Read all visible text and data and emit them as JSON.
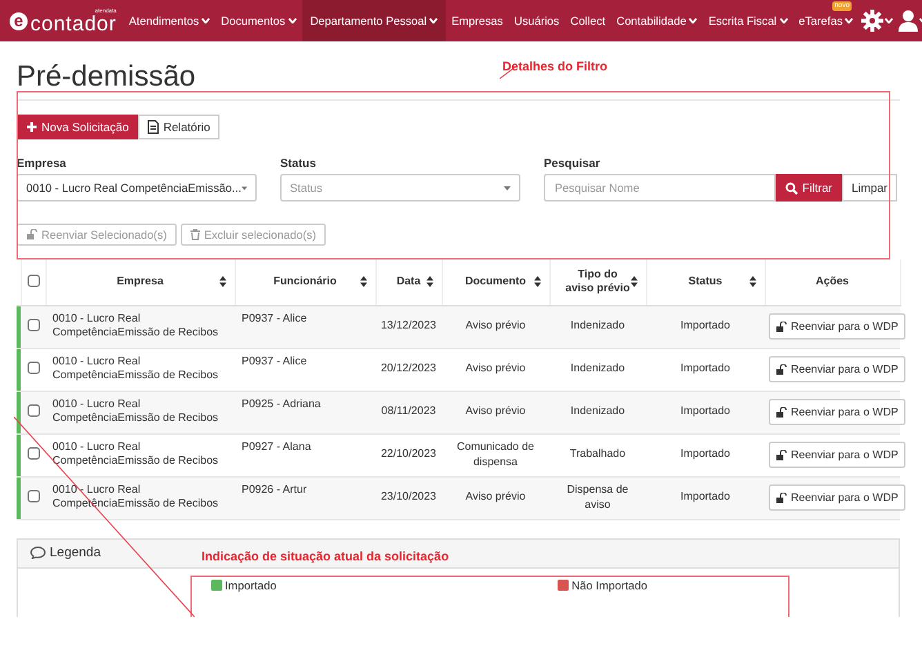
{
  "navbar": {
    "logo": {
      "mark": "e",
      "text": "contador",
      "tagline": "atendata"
    },
    "items": [
      {
        "label": "Atendimentos",
        "dropdown": true,
        "selected": false
      },
      {
        "label": "Documentos",
        "dropdown": true,
        "selected": false
      },
      {
        "label": "Departamento Pessoal",
        "dropdown": true,
        "selected": true
      },
      {
        "label": "Empresas",
        "dropdown": false,
        "selected": false
      },
      {
        "label": "Usuários",
        "dropdown": false,
        "selected": false
      },
      {
        "label": "Collect",
        "dropdown": false,
        "selected": false
      },
      {
        "label": "Contabilidade",
        "dropdown": true,
        "selected": false
      },
      {
        "label": "Escrita Fiscal",
        "dropdown": true,
        "selected": false
      },
      {
        "label": "eTarefas",
        "dropdown": true,
        "selected": false,
        "badge": "novo"
      }
    ]
  },
  "page_title": "Pré-demissão",
  "toolbar": [
    {
      "label": "Nova Solicitação",
      "kind": "primary"
    },
    {
      "label": "Relatório",
      "kind": "default"
    }
  ],
  "filters": {
    "empresa": {
      "label": "Empresa",
      "value": "0010 - Lucro Real CompetênciaEmissão..."
    },
    "status": {
      "label": "Status",
      "placeholder": "Status"
    },
    "search": {
      "label": "Pesquisar",
      "placeholder": "Pesquisar Nome",
      "buttons": [
        "Filtrar",
        "Limpar"
      ]
    }
  },
  "bulk_actions": [
    {
      "label": "Reenviar Selecionado(s)",
      "kind": "resend",
      "disabled": true
    },
    {
      "label": "Excluir selecionado(s)",
      "kind": "delete",
      "disabled": true
    }
  ],
  "table": {
    "select_all": {
      "checked": false
    },
    "columns": [
      {
        "label": "Empresa",
        "sortable": true
      },
      {
        "label": "Funcionário",
        "sortable": true
      },
      {
        "label": "Data",
        "sortable": true
      },
      {
        "label": "Documento",
        "sortable": true
      },
      {
        "label": "Tipo do aviso prévio",
        "sortable": true
      },
      {
        "label": "Status",
        "sortable": true
      },
      {
        "label": "Ações",
        "sortable": false
      }
    ],
    "rows": [
      {
        "color": "#5cb85c",
        "checked": false,
        "cells": [
          "0010 - Lucro Real CompetênciaEmissão de Recibos",
          "P0937 - Alice",
          "13/12/2023",
          "Aviso prévio",
          "Indenizado",
          "Importado"
        ],
        "action": "Reenviar para o WDP"
      },
      {
        "color": "#5cb85c",
        "checked": false,
        "cells": [
          "0010 - Lucro Real CompetênciaEmissão de Recibos",
          "P0937 - Alice",
          "20/12/2023",
          "Aviso prévio",
          "Indenizado",
          "Importado"
        ],
        "action": "Reenviar para o WDP"
      },
      {
        "color": "#5cb85c",
        "checked": false,
        "cells": [
          "0010 - Lucro Real CompetênciaEmissão de Recibos",
          "P0925 - Adriana",
          "08/11/2023",
          "Aviso prévio",
          "Indenizado",
          "Importado"
        ],
        "action": "Reenviar para o WDP"
      },
      {
        "color": "#5cb85c",
        "checked": false,
        "cells": [
          "0010 - Lucro Real CompetênciaEmissão de Recibos",
          "P0927 - Alana",
          "22/10/2023",
          "Comunicado de dispensa",
          "Trabalhado",
          "Importado"
        ],
        "action": "Reenviar para o WDP"
      },
      {
        "color": "#5cb85c",
        "checked": false,
        "cells": [
          "0010 - Lucro Real CompetênciaEmissão de Recibos",
          "P0926 - Artur",
          "23/10/2023",
          "Aviso prévio",
          "Dispensa de aviso",
          "Importado"
        ],
        "action": "Reenviar para o WDP"
      }
    ]
  },
  "legend": {
    "title": "Legenda",
    "items": [
      {
        "label": "Importado",
        "color": "#5cb85c"
      },
      {
        "label": "Não Importado",
        "color": "#d9534f"
      }
    ]
  },
  "annotations": [
    {
      "kind": "filter",
      "text": "Detalhes do Filtro"
    },
    {
      "kind": "legend",
      "text": "Indicação de situação atual da solicitação"
    }
  ]
}
